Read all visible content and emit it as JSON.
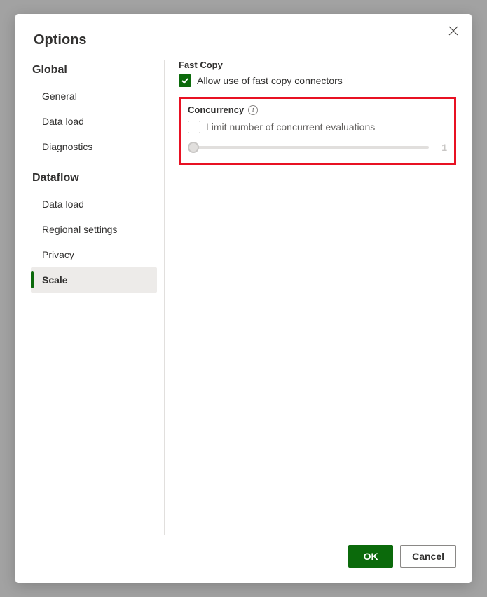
{
  "dialog": {
    "title": "Options",
    "close_aria": "Close"
  },
  "sidebar": {
    "groups": [
      {
        "header": "Global",
        "items": [
          {
            "label": "General"
          },
          {
            "label": "Data load"
          },
          {
            "label": "Diagnostics"
          }
        ]
      },
      {
        "header": "Dataflow",
        "items": [
          {
            "label": "Data load"
          },
          {
            "label": "Regional settings"
          },
          {
            "label": "Privacy"
          },
          {
            "label": "Scale",
            "active": true
          }
        ]
      }
    ]
  },
  "content": {
    "fast_copy": {
      "section_label": "Fast Copy",
      "checkbox_label": "Allow use of fast copy connectors",
      "checked": true
    },
    "concurrency": {
      "section_label": "Concurrency",
      "checkbox_label": "Limit number of concurrent evaluations",
      "checked": false,
      "slider_value": "1"
    }
  },
  "footer": {
    "ok": "OK",
    "cancel": "Cancel"
  }
}
